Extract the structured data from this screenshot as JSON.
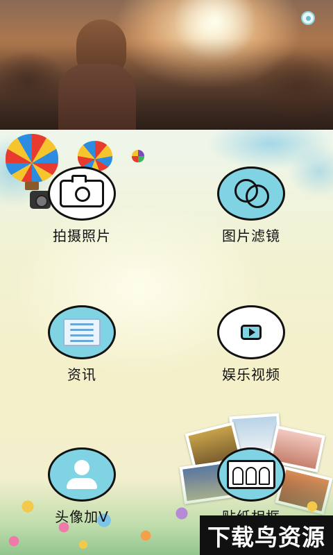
{
  "header": {
    "settings_icon": "settings-icon"
  },
  "menu": {
    "items": [
      {
        "label": "拍摄照片",
        "icon": "camera-icon"
      },
      {
        "label": "图片滤镜",
        "icon": "filter-icon"
      },
      {
        "label": "资讯",
        "icon": "news-icon"
      },
      {
        "label": "娱乐视频",
        "icon": "video-icon"
      },
      {
        "label": "头像加V",
        "icon": "avatar-icon"
      },
      {
        "label": "贴纸相框",
        "icon": "photo-frame-icon"
      }
    ]
  },
  "watermark": {
    "text": "下载鸟资源"
  },
  "colors": {
    "accent": "#7fd3e3",
    "outline": "#111111"
  }
}
